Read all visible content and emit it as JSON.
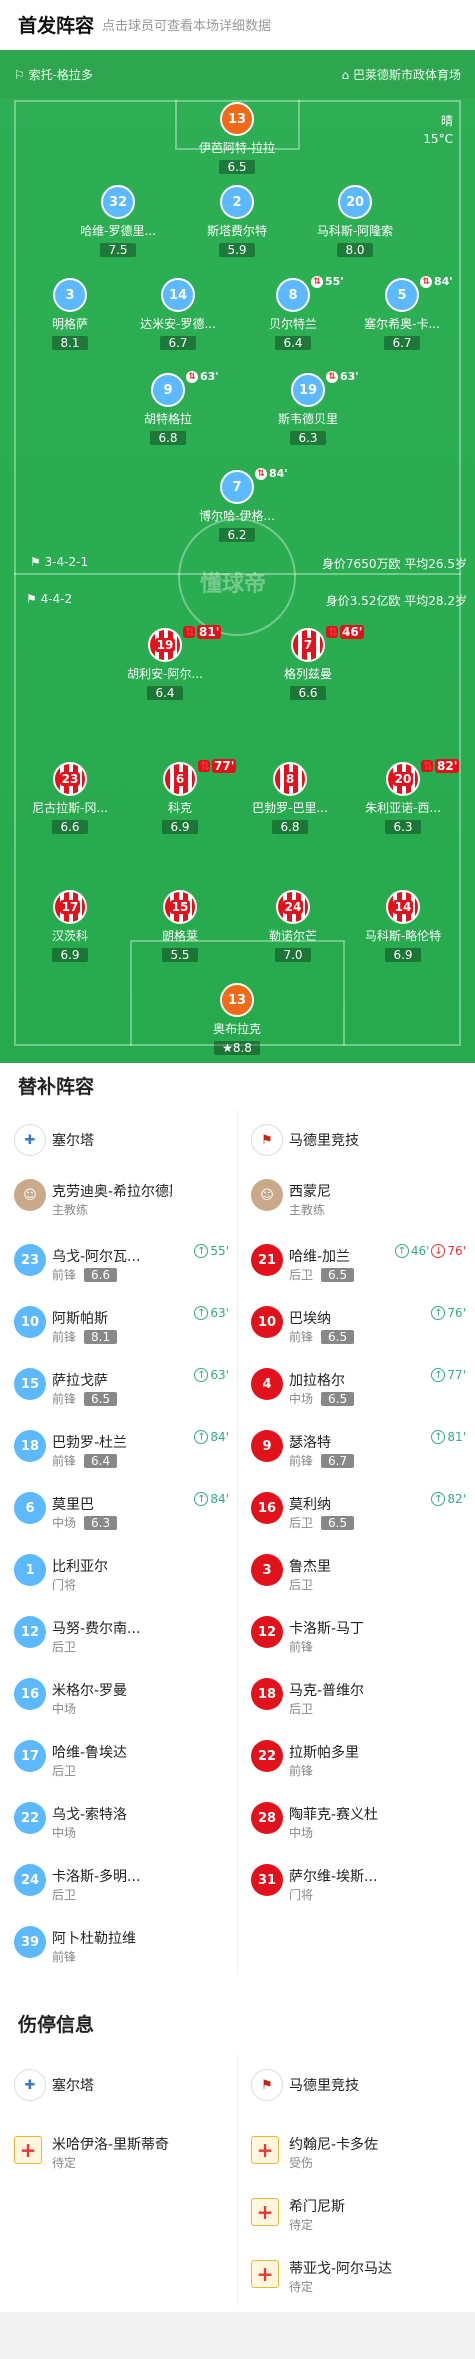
{
  "header": {
    "title": "首发阵容",
    "subtitle": "点击球员可查看本场详细数据"
  },
  "venue": {
    "coach_home": "索托-格拉多",
    "stadium": "巴莱德斯市政体育场",
    "weather": "晴",
    "temp": "15°C"
  },
  "formation": {
    "home": "3-4-2-1",
    "home_value": "身价7650万欧 平均26.5岁",
    "away": "4-4-2",
    "away_value": "身价3.52亿欧 平均28.2岁",
    "watermark": "懂球帝"
  },
  "home_players": [
    {
      "num": "13",
      "name": "伊芭阿特-拉拉",
      "rating": "6.5"
    },
    {
      "num": "32",
      "name": "哈维-罗德里...",
      "rating": "7.5"
    },
    {
      "num": "2",
      "name": "斯塔费尔特",
      "rating": "5.9"
    },
    {
      "num": "20",
      "name": "马科斯-阿隆索",
      "rating": "8.0"
    },
    {
      "num": "3",
      "name": "明格萨",
      "rating": "8.1"
    },
    {
      "num": "14",
      "name": "达米安-罗德...",
      "rating": "6.7"
    },
    {
      "num": "8",
      "name": "贝尔特兰",
      "rating": "6.4",
      "ev": "55'"
    },
    {
      "num": "5",
      "name": "塞尔希奥-卡...",
      "rating": "6.7",
      "ev": "84'"
    },
    {
      "num": "9",
      "name": "胡特格拉",
      "rating": "6.8",
      "ev": "63'"
    },
    {
      "num": "19",
      "name": "斯韦德贝里",
      "rating": "6.3",
      "ev": "63'"
    },
    {
      "num": "7",
      "name": "博尔哈-伊格...",
      "rating": "6.2",
      "ev": "84'"
    }
  ],
  "away_players": [
    {
      "num": "19",
      "name": "胡利安-阿尔...",
      "rating": "6.4",
      "ev": "81'"
    },
    {
      "num": "7",
      "name": "格列兹曼",
      "rating": "6.6",
      "ev": "46'"
    },
    {
      "num": "23",
      "name": "尼古拉斯-冈...",
      "rating": "6.6"
    },
    {
      "num": "6",
      "name": "科克",
      "rating": "6.9",
      "ev": "77'"
    },
    {
      "num": "8",
      "name": "巴勃罗-巴里...",
      "rating": "6.8"
    },
    {
      "num": "20",
      "name": "朱利亚诺-西...",
      "rating": "6.3",
      "ev": "82'"
    },
    {
      "num": "17",
      "name": "汉茨科",
      "rating": "6.9"
    },
    {
      "num": "15",
      "name": "朗格莱",
      "rating": "5.5"
    },
    {
      "num": "24",
      "name": "勒诺尔芒",
      "rating": "7.0"
    },
    {
      "num": "14",
      "name": "马科斯-略伦特",
      "rating": "6.9"
    },
    {
      "num": "13",
      "name": "奥布拉克",
      "rating": "8.8"
    }
  ],
  "subs_title": "替补阵容",
  "teams": {
    "home": "塞尔塔",
    "away": "马德里竞技"
  },
  "coaches": {
    "home": "克劳迪奥-希拉尔德斯",
    "away": "西蒙尼",
    "role": "主教练"
  },
  "subs_home": [
    {
      "num": "23",
      "name": "乌戈-阿尔瓦...",
      "pos": "前锋",
      "rating": "6.6",
      "ev": "55'"
    },
    {
      "num": "10",
      "name": "阿斯帕斯",
      "pos": "前锋",
      "rating": "8.1",
      "ev": "63'"
    },
    {
      "num": "15",
      "name": "萨拉戈萨",
      "pos": "前锋",
      "rating": "6.5",
      "ev": "63'"
    },
    {
      "num": "18",
      "name": "巴勃罗-杜兰",
      "pos": "前锋",
      "rating": "6.4",
      "ev": "84'"
    },
    {
      "num": "6",
      "name": "莫里巴",
      "pos": "中场",
      "rating": "6.3",
      "ev": "84'"
    },
    {
      "num": "1",
      "name": "比利亚尔",
      "pos": "门将"
    },
    {
      "num": "12",
      "name": "马努-费尔南...",
      "pos": "后卫"
    },
    {
      "num": "16",
      "name": "米格尔-罗曼",
      "pos": "中场"
    },
    {
      "num": "17",
      "name": "哈维-鲁埃达",
      "pos": "后卫"
    },
    {
      "num": "22",
      "name": "乌戈-索特洛",
      "pos": "中场"
    },
    {
      "num": "24",
      "name": "卡洛斯-多明...",
      "pos": "后卫"
    },
    {
      "num": "39",
      "name": "阿卜杜勒拉维",
      "pos": "前锋"
    }
  ],
  "subs_away": [
    {
      "num": "21",
      "name": "哈维-加兰",
      "pos": "后卫",
      "rating": "6.5",
      "ev": "46'",
      "ev2": "76'"
    },
    {
      "num": "10",
      "name": "巴埃纳",
      "pos": "前锋",
      "rating": "6.5",
      "ev": "76'"
    },
    {
      "num": "4",
      "name": "加拉格尔",
      "pos": "中场",
      "rating": "6.5",
      "ev": "77'"
    },
    {
      "num": "9",
      "name": "瑟洛特",
      "pos": "前锋",
      "rating": "6.7",
      "ev": "81'"
    },
    {
      "num": "16",
      "name": "莫利纳",
      "pos": "后卫",
      "rating": "6.5",
      "ev": "82'"
    },
    {
      "num": "3",
      "name": "鲁杰里",
      "pos": "后卫"
    },
    {
      "num": "12",
      "name": "卡洛斯-马丁",
      "pos": "前锋"
    },
    {
      "num": "18",
      "name": "马克-普维尔",
      "pos": "后卫"
    },
    {
      "num": "22",
      "name": "拉斯帕多里",
      "pos": "前锋"
    },
    {
      "num": "28",
      "name": "陶菲克-赛义杜",
      "pos": "中场"
    },
    {
      "num": "31",
      "name": "萨尔维-埃斯...",
      "pos": "门将"
    }
  ],
  "injury": {
    "title": "伤停信息",
    "home": [
      {
        "name": "米哈伊洛-里斯蒂奇",
        "status": "待定"
      }
    ],
    "away": [
      {
        "name": "约翰尼-卡多佐",
        "status": "受伤"
      },
      {
        "name": "希门尼斯",
        "status": "待定"
      },
      {
        "name": "蒂亚戈-阿尔马达",
        "status": "待定"
      }
    ]
  }
}
